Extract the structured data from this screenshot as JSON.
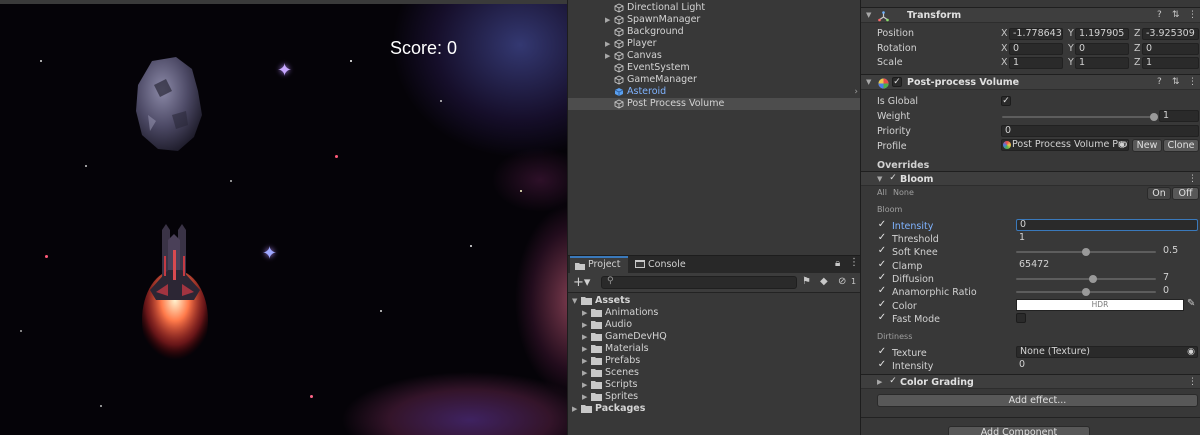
{
  "game": {
    "score_text": "Score: 0"
  },
  "hierarchy": {
    "items": [
      {
        "label": "Directional Light",
        "expandable": false
      },
      {
        "label": "SpawnManager",
        "expandable": true
      },
      {
        "label": "Background",
        "expandable": false
      },
      {
        "label": "Player",
        "expandable": true
      },
      {
        "label": "Canvas",
        "expandable": true
      },
      {
        "label": "EventSystem",
        "expandable": false
      },
      {
        "label": "GameManager",
        "expandable": false
      },
      {
        "label": "Asteroid",
        "expandable": false
      },
      {
        "label": "Post Process Volume",
        "expandable": false
      }
    ]
  },
  "project": {
    "tabs": [
      "Project",
      "Console"
    ],
    "hidden_count": "1",
    "tree": [
      {
        "label": "Assets",
        "level": 0,
        "expanded": true
      },
      {
        "label": "Animations",
        "level": 1
      },
      {
        "label": "Audio",
        "level": 1
      },
      {
        "label": "GameDevHQ",
        "level": 1
      },
      {
        "label": "Materials",
        "level": 1
      },
      {
        "label": "Prefabs",
        "level": 1
      },
      {
        "label": "Scenes",
        "level": 1
      },
      {
        "label": "Scripts",
        "level": 1
      },
      {
        "label": "Sprites",
        "level": 1
      },
      {
        "label": "Packages",
        "level": 0,
        "expanded": false
      }
    ]
  },
  "inspector": {
    "transform": {
      "title": "Transform",
      "position_label": "Position",
      "rotation_label": "Rotation",
      "scale_label": "Scale",
      "position": {
        "x": "-1.778643",
        "y": "1.197905",
        "z": "-3.925309"
      },
      "rotation": {
        "x": "0",
        "y": "0",
        "z": "0"
      },
      "scale": {
        "x": "1",
        "y": "1",
        "z": "1"
      }
    },
    "postprocess": {
      "title": "Post-process Volume",
      "is_global_label": "Is Global",
      "weight_label": "Weight",
      "weight_value": "1",
      "weight_fraction": 1.0,
      "priority_label": "Priority",
      "priority_value": "0",
      "profile_label": "Profile",
      "profile_value": "Post Process Volume Prof",
      "new_button": "New",
      "clone_button": "Clone",
      "overrides_label": "Overrides"
    },
    "bloom": {
      "title": "Bloom",
      "all_label": "All",
      "none_label": "None",
      "on_button": "On",
      "off_button": "Off",
      "section_label": "Bloom",
      "intensity_label": "Intensity",
      "intensity_value": "0",
      "threshold_label": "Threshold",
      "threshold_value": "1",
      "soft_knee_label": "Soft Knee",
      "soft_knee_value": "0.5",
      "soft_knee_fraction": 0.5,
      "clamp_label": "Clamp",
      "clamp_value": "65472",
      "diffusion_label": "Diffusion",
      "diffusion_value": "7",
      "diffusion_fraction": 0.55,
      "anamorphic_label": "Anamorphic Ratio",
      "anamorphic_value": "0",
      "anamorphic_fraction": 0.5,
      "color_label": "Color",
      "color_value": "HDR",
      "fast_mode_label": "Fast Mode",
      "dirtiness_label": "Dirtiness",
      "texture_label": "Texture",
      "texture_value": "None (Texture)",
      "dirt_intensity_label": "Intensity",
      "dirt_intensity_value": "0"
    },
    "color_grading": {
      "title": "Color Grading"
    },
    "add_effect_button": "Add effect...",
    "add_component_button": "Add Component"
  },
  "colors": {
    "accent": "#3a79bb",
    "link": "#7fb3ff",
    "panel": "#383838"
  }
}
